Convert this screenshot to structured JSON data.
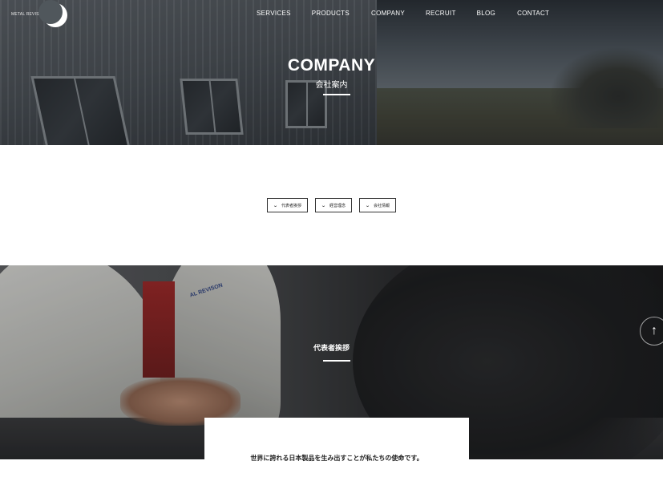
{
  "header": {
    "logo_text": "METAL REVISION",
    "nav": [
      "SERVICES",
      "PRODUCTS",
      "COMPANY",
      "RECRUIT",
      "BLOG",
      "CONTACT"
    ]
  },
  "hero": {
    "title": "COMPANY",
    "subtitle": "会社案内"
  },
  "anchors": [
    {
      "label": "代表者挨拶"
    },
    {
      "label": "経営理念"
    },
    {
      "label": "会社情報"
    }
  ],
  "message_section": {
    "heading": "代表者挨拶",
    "photo_jacket_text": "AL REVISON",
    "lead": "世界に誇れる日本製品を生み出すことが私たちの使命です。"
  },
  "icons": {
    "scroll_up": "arrow-up-icon",
    "anchor_chevron": "chevron-down-icon"
  }
}
